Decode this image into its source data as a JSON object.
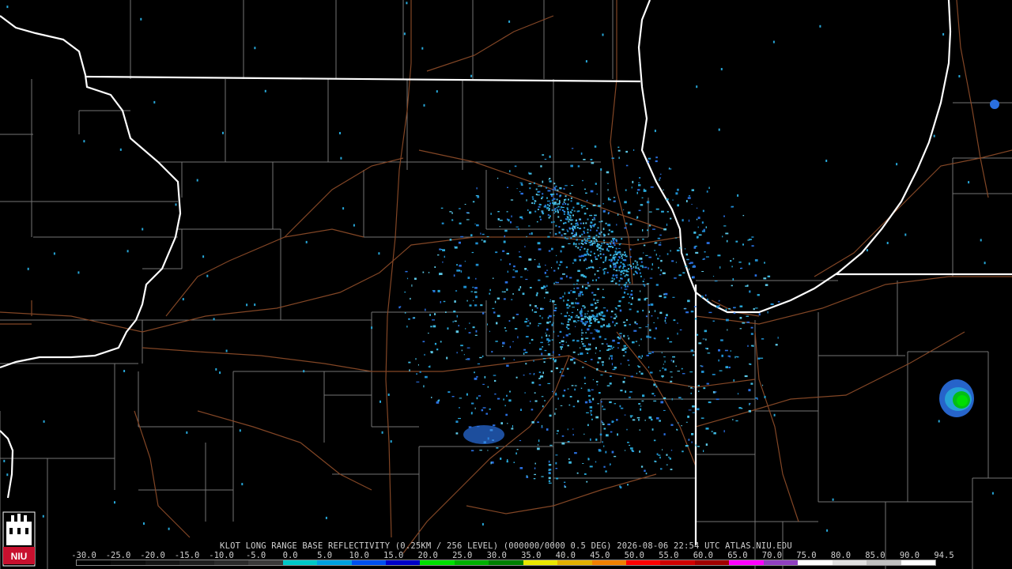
{
  "title": "KLOT LONG RANGE BASE REFLECTIVITY (0.25KM / 256 LEVEL) (000000/0000 0.5 DEG) 2026-08-06 22:54 UTC  ATLAS.NIU.EDU",
  "logo_text": "NIU",
  "legend": {
    "ticks": [
      "-30.0",
      "-25.0",
      "-20.0",
      "-15.0",
      "-10.0",
      "-5.0",
      "0.0",
      "5.0",
      "10.0",
      "15.0",
      "20.0",
      "25.0",
      "30.0",
      "35.0",
      "40.0",
      "45.0",
      "50.0",
      "55.0",
      "60.0",
      "65.0",
      "70.0",
      "75.0",
      "80.0",
      "85.0",
      "90.0",
      "94.5"
    ],
    "colors": [
      "#000000",
      "#0a0a0a",
      "#141414",
      "#1e1e1e",
      "#2a2a2a",
      "#3a3a3a",
      "#00c8c8",
      "#00a0e0",
      "#0050f0",
      "#0000c8",
      "#00e000",
      "#00b000",
      "#008000",
      "#e8e800",
      "#e0b000",
      "#f08000",
      "#ff0000",
      "#d00000",
      "#a00000",
      "#ff00ff",
      "#9040c0",
      "#ffffff",
      "#e0e0e0",
      "#c0c0c0",
      "#ffffff"
    ],
    "accent_echo": "#27a7d8"
  }
}
